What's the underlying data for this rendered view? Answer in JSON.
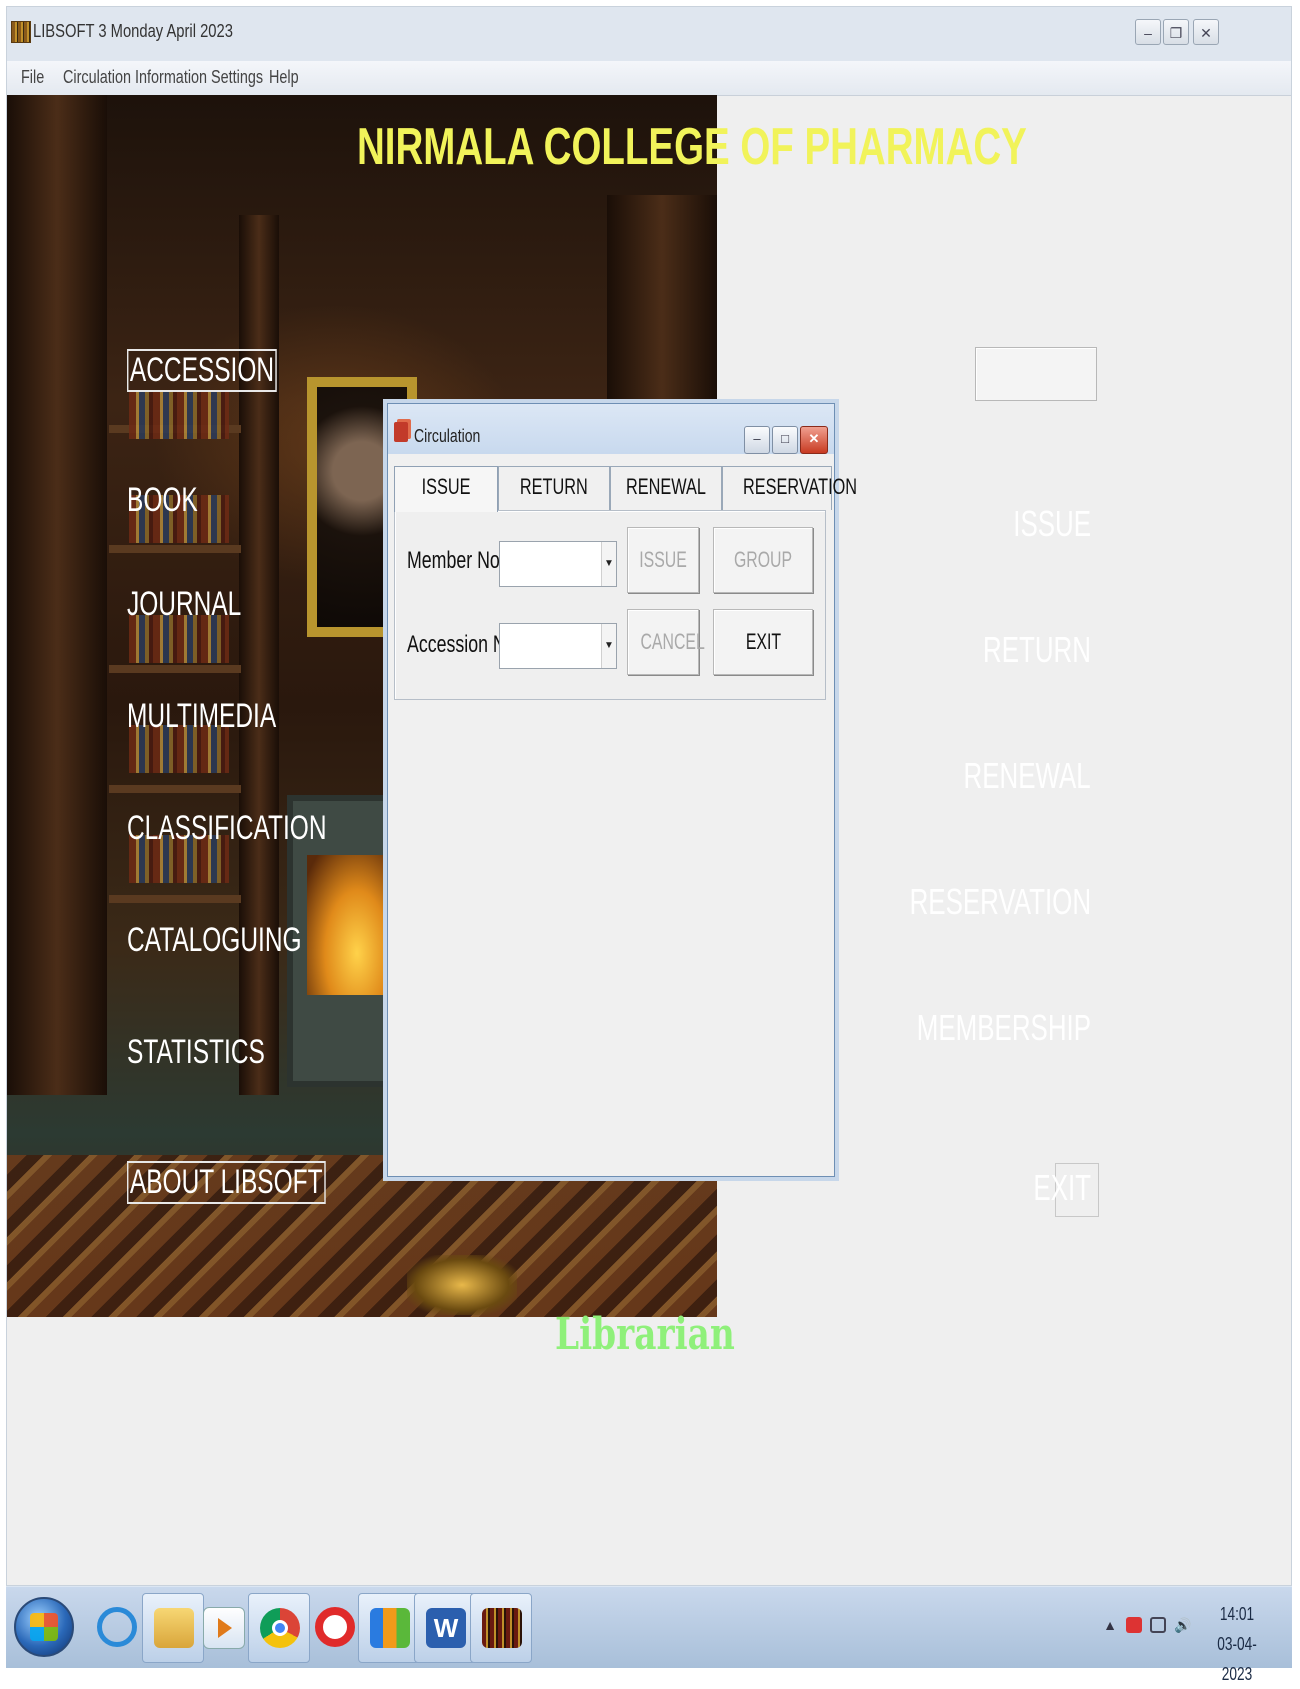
{
  "window": {
    "title": "LIBSOFT   3 Monday April 2023"
  },
  "menu": [
    "File",
    "Circulation",
    "Information",
    "Settings",
    "Help"
  ],
  "banner": "NIRMALA COLLEGE OF PHARMACY",
  "sidebar": [
    "ACCESSION",
    "BOOK",
    "JOURNAL",
    "MULTIMEDIA",
    "CLASSIFICATION",
    "CATALOGUING",
    "STATISTICS",
    "ABOUT LIBSOFT"
  ],
  "right_panel": [
    "ISSUE",
    "RETURN",
    "RENEWAL",
    "RESERVATION",
    "MEMBERSHIP"
  ],
  "right_exit": "EXIT",
  "footer_role": "Librarian",
  "dialog": {
    "title": "Circulation",
    "tabs": [
      "ISSUE",
      "RETURN",
      "RENEWAL",
      "RESERVATION"
    ],
    "active_tab": "ISSUE",
    "member_label": "Member No:",
    "member_value": "",
    "accession_label": "Accession No:",
    "accession_value": "",
    "buttons": {
      "issue": "ISSUE",
      "group_issue": "GROUP ISSUE",
      "cancel": "CANCEL",
      "exit": "EXIT"
    }
  },
  "taskbar": {
    "apps": [
      "start-button",
      "internet-explorer",
      "file-explorer",
      "media-player",
      "chrome",
      "opera",
      "folder-app",
      "word",
      "libsoft"
    ],
    "clock_time": "14:01",
    "clock_date": "03-04-2023"
  },
  "colors": {
    "banner": "#f1f35a",
    "librarian": "#8ff07a",
    "titlebar": "#dfe6ef"
  }
}
